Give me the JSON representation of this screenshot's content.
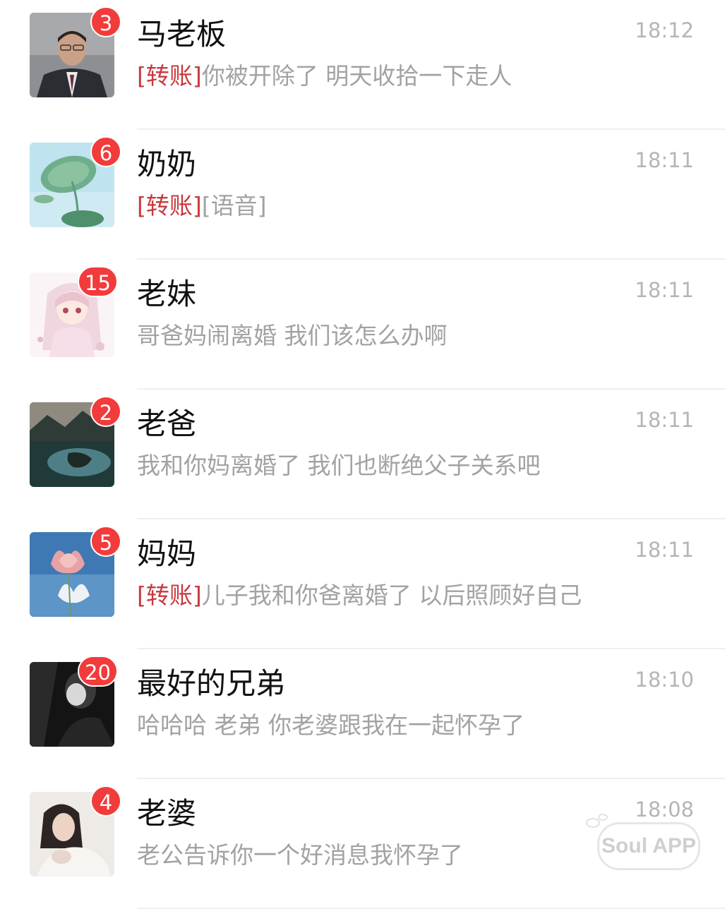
{
  "chats": [
    {
      "name": "马老板",
      "time": "18:12",
      "unread": "3",
      "tag": "[转账]",
      "message": "你被开除了 明天收拾一下走人",
      "avatar_icon": "man-in-suit-avatar-icon"
    },
    {
      "name": "奶奶",
      "time": "18:11",
      "unread": "6",
      "tag": "[转账]",
      "message": "[语音]",
      "avatar_icon": "lotus-leaf-avatar-icon"
    },
    {
      "name": "老妹",
      "time": "18:11",
      "unread": "15",
      "tag": "",
      "message": "哥爸妈闹离婚 我们该怎么办啊",
      "avatar_icon": "anime-girl-avatar-icon"
    },
    {
      "name": "老爸",
      "time": "18:11",
      "unread": "2",
      "tag": "",
      "message": "我和你妈离婚了 我们也断绝父子关系吧",
      "avatar_icon": "mountain-lake-avatar-icon"
    },
    {
      "name": "妈妈",
      "time": "18:11",
      "unread": "5",
      "tag": "[转账]",
      "message": "儿子我和你爸离婚了 以后照顾好自己",
      "avatar_icon": "lotus-flower-avatar-icon"
    },
    {
      "name": "最好的兄弟",
      "time": "18:10",
      "unread": "20",
      "tag": "",
      "message": "哈哈哈 老弟 你老婆跟我在一起怀孕了",
      "avatar_icon": "dark-portrait-avatar-icon"
    },
    {
      "name": "老婆",
      "time": "18:08",
      "unread": "4",
      "tag": "",
      "message": "老公告诉你一个好消息我怀孕了",
      "avatar_icon": "sleeping-woman-avatar-icon"
    }
  ],
  "watermark": {
    "text": "Soul APP"
  },
  "colors": {
    "badge": "#f23b3b",
    "tag": "#c8393d",
    "name": "#111111",
    "preview": "#a2a2a2",
    "time": "#b5b5b5"
  }
}
